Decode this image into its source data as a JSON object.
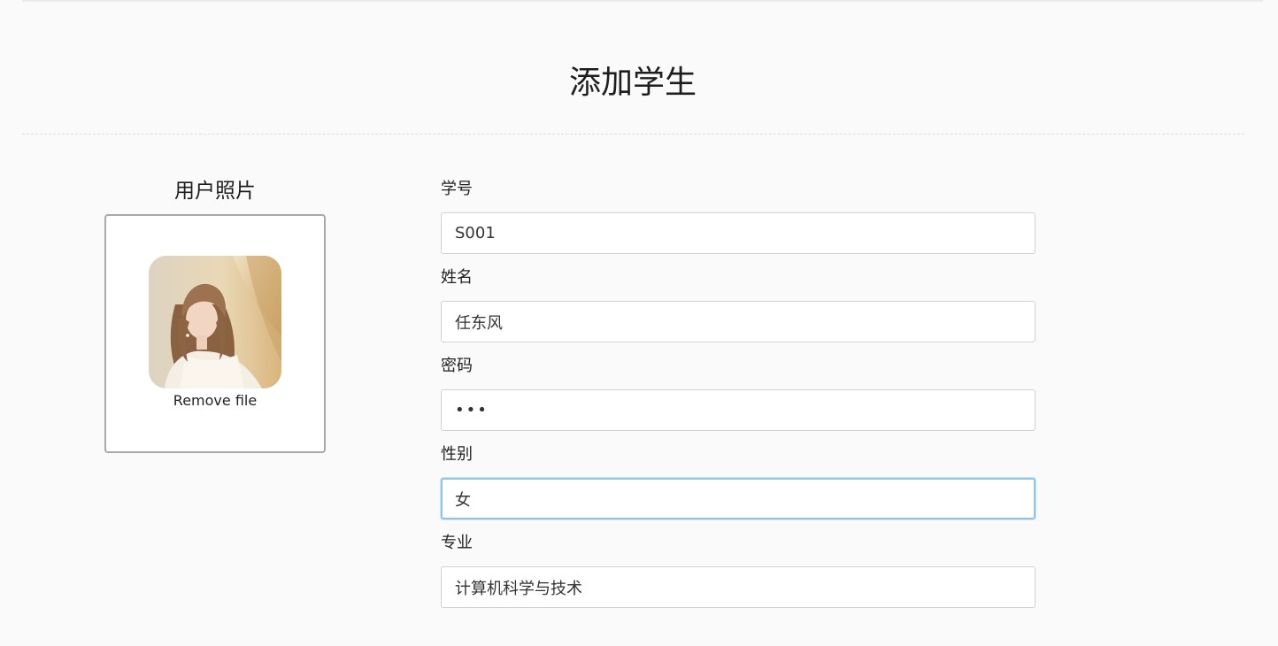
{
  "page": {
    "title": "添加学生"
  },
  "photo": {
    "title": "用户照片",
    "remove_label": "Remove file"
  },
  "form": {
    "fields": [
      {
        "label": "学号",
        "value": "S001"
      },
      {
        "label": "姓名",
        "value": "任东风"
      },
      {
        "label": "密码",
        "value": "•••"
      },
      {
        "label": "性别",
        "value": "女"
      },
      {
        "label": "专业",
        "value": "计算机科学与技术"
      }
    ]
  },
  "colors": {
    "background": "#fafafa",
    "focus_border": "#8cc4ef",
    "input_border": "#d2d2d2",
    "dropzone_border": "#a9a9a9"
  }
}
